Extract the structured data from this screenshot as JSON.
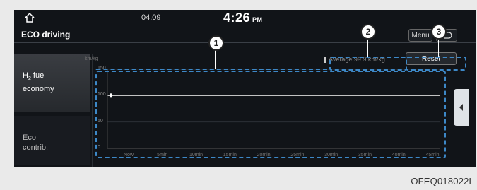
{
  "status": {
    "date": "04.09",
    "time": "4:26",
    "ampm": "PM"
  },
  "header": {
    "title": "ECO driving",
    "menu_label": "Menu"
  },
  "tabs": [
    {
      "label_line1": "H",
      "subscript": "2",
      "label_rest": " fuel",
      "label_line2": "economy"
    },
    {
      "label_line1": "Eco",
      "label_line2": "contrib."
    }
  ],
  "chart": {
    "average_text": "Average 99.9 km/kg",
    "reset_label": "Reset",
    "unit": "km/kg",
    "y_ticks": [
      "150",
      "100",
      "50",
      "0"
    ],
    "x_ticks": [
      "Now",
      "5min",
      "10min",
      "15min",
      "20min",
      "25min",
      "30min",
      "35min",
      "40min",
      "45min"
    ]
  },
  "chart_data": {
    "type": "line",
    "ylabel": "km/kg",
    "x": [
      "Now",
      "5min",
      "10min",
      "15min",
      "20min",
      "25min",
      "30min",
      "35min",
      "40min",
      "45min"
    ],
    "ylim": [
      0,
      150
    ],
    "series": [
      {
        "values": [
          100
        ]
      }
    ],
    "average_value": 99.9
  },
  "callouts": [
    "1",
    "2",
    "3"
  ],
  "figure_code": "OFEQ018022L",
  "colors": {
    "screen_bg": "#111418",
    "annotation": "#3d88c7"
  }
}
